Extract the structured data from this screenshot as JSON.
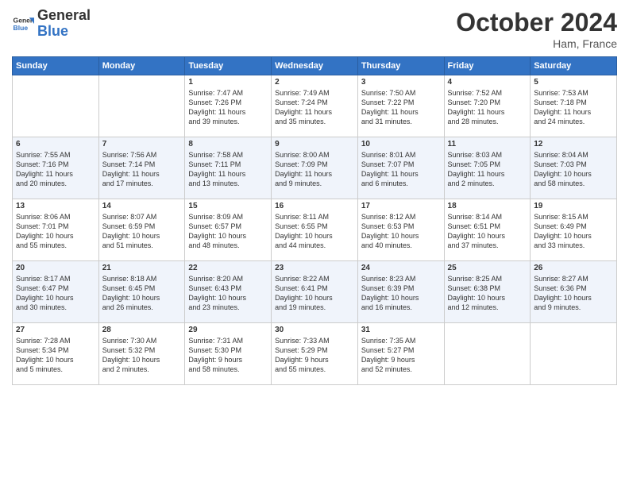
{
  "logo": {
    "line1": "General",
    "line2": "Blue"
  },
  "title": "October 2024",
  "location": "Ham, France",
  "days_header": [
    "Sunday",
    "Monday",
    "Tuesday",
    "Wednesday",
    "Thursday",
    "Friday",
    "Saturday"
  ],
  "weeks": [
    [
      {
        "day": "",
        "info": ""
      },
      {
        "day": "",
        "info": ""
      },
      {
        "day": "1",
        "info": "Sunrise: 7:47 AM\nSunset: 7:26 PM\nDaylight: 11 hours\nand 39 minutes."
      },
      {
        "day": "2",
        "info": "Sunrise: 7:49 AM\nSunset: 7:24 PM\nDaylight: 11 hours\nand 35 minutes."
      },
      {
        "day": "3",
        "info": "Sunrise: 7:50 AM\nSunset: 7:22 PM\nDaylight: 11 hours\nand 31 minutes."
      },
      {
        "day": "4",
        "info": "Sunrise: 7:52 AM\nSunset: 7:20 PM\nDaylight: 11 hours\nand 28 minutes."
      },
      {
        "day": "5",
        "info": "Sunrise: 7:53 AM\nSunset: 7:18 PM\nDaylight: 11 hours\nand 24 minutes."
      }
    ],
    [
      {
        "day": "6",
        "info": "Sunrise: 7:55 AM\nSunset: 7:16 PM\nDaylight: 11 hours\nand 20 minutes."
      },
      {
        "day": "7",
        "info": "Sunrise: 7:56 AM\nSunset: 7:14 PM\nDaylight: 11 hours\nand 17 minutes."
      },
      {
        "day": "8",
        "info": "Sunrise: 7:58 AM\nSunset: 7:11 PM\nDaylight: 11 hours\nand 13 minutes."
      },
      {
        "day": "9",
        "info": "Sunrise: 8:00 AM\nSunset: 7:09 PM\nDaylight: 11 hours\nand 9 minutes."
      },
      {
        "day": "10",
        "info": "Sunrise: 8:01 AM\nSunset: 7:07 PM\nDaylight: 11 hours\nand 6 minutes."
      },
      {
        "day": "11",
        "info": "Sunrise: 8:03 AM\nSunset: 7:05 PM\nDaylight: 11 hours\nand 2 minutes."
      },
      {
        "day": "12",
        "info": "Sunrise: 8:04 AM\nSunset: 7:03 PM\nDaylight: 10 hours\nand 58 minutes."
      }
    ],
    [
      {
        "day": "13",
        "info": "Sunrise: 8:06 AM\nSunset: 7:01 PM\nDaylight: 10 hours\nand 55 minutes."
      },
      {
        "day": "14",
        "info": "Sunrise: 8:07 AM\nSunset: 6:59 PM\nDaylight: 10 hours\nand 51 minutes."
      },
      {
        "day": "15",
        "info": "Sunrise: 8:09 AM\nSunset: 6:57 PM\nDaylight: 10 hours\nand 48 minutes."
      },
      {
        "day": "16",
        "info": "Sunrise: 8:11 AM\nSunset: 6:55 PM\nDaylight: 10 hours\nand 44 minutes."
      },
      {
        "day": "17",
        "info": "Sunrise: 8:12 AM\nSunset: 6:53 PM\nDaylight: 10 hours\nand 40 minutes."
      },
      {
        "day": "18",
        "info": "Sunrise: 8:14 AM\nSunset: 6:51 PM\nDaylight: 10 hours\nand 37 minutes."
      },
      {
        "day": "19",
        "info": "Sunrise: 8:15 AM\nSunset: 6:49 PM\nDaylight: 10 hours\nand 33 minutes."
      }
    ],
    [
      {
        "day": "20",
        "info": "Sunrise: 8:17 AM\nSunset: 6:47 PM\nDaylight: 10 hours\nand 30 minutes."
      },
      {
        "day": "21",
        "info": "Sunrise: 8:18 AM\nSunset: 6:45 PM\nDaylight: 10 hours\nand 26 minutes."
      },
      {
        "day": "22",
        "info": "Sunrise: 8:20 AM\nSunset: 6:43 PM\nDaylight: 10 hours\nand 23 minutes."
      },
      {
        "day": "23",
        "info": "Sunrise: 8:22 AM\nSunset: 6:41 PM\nDaylight: 10 hours\nand 19 minutes."
      },
      {
        "day": "24",
        "info": "Sunrise: 8:23 AM\nSunset: 6:39 PM\nDaylight: 10 hours\nand 16 minutes."
      },
      {
        "day": "25",
        "info": "Sunrise: 8:25 AM\nSunset: 6:38 PM\nDaylight: 10 hours\nand 12 minutes."
      },
      {
        "day": "26",
        "info": "Sunrise: 8:27 AM\nSunset: 6:36 PM\nDaylight: 10 hours\nand 9 minutes."
      }
    ],
    [
      {
        "day": "27",
        "info": "Sunrise: 7:28 AM\nSunset: 5:34 PM\nDaylight: 10 hours\nand 5 minutes."
      },
      {
        "day": "28",
        "info": "Sunrise: 7:30 AM\nSunset: 5:32 PM\nDaylight: 10 hours\nand 2 minutes."
      },
      {
        "day": "29",
        "info": "Sunrise: 7:31 AM\nSunset: 5:30 PM\nDaylight: 9 hours\nand 58 minutes."
      },
      {
        "day": "30",
        "info": "Sunrise: 7:33 AM\nSunset: 5:29 PM\nDaylight: 9 hours\nand 55 minutes."
      },
      {
        "day": "31",
        "info": "Sunrise: 7:35 AM\nSunset: 5:27 PM\nDaylight: 9 hours\nand 52 minutes."
      },
      {
        "day": "",
        "info": ""
      },
      {
        "day": "",
        "info": ""
      }
    ]
  ]
}
